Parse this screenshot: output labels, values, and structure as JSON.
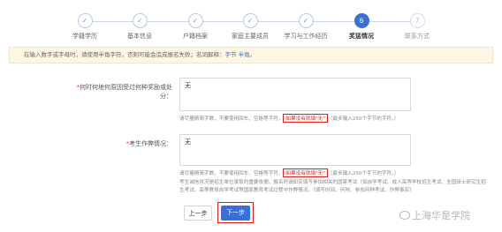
{
  "stepper": {
    "steps": [
      {
        "label": "学籍学历",
        "mark": "✓",
        "state": "done"
      },
      {
        "label": "基本信息",
        "mark": "✓",
        "state": "done"
      },
      {
        "label": "户籍档案",
        "mark": "✓",
        "state": "done"
      },
      {
        "label": "家庭主要成员",
        "mark": "✓",
        "state": "done"
      },
      {
        "label": "学习与工作经历",
        "mark": "✓",
        "state": "done"
      },
      {
        "label": "奖惩情况",
        "mark": "6",
        "state": "active"
      },
      {
        "label": "联系方式",
        "mark": "7",
        "state": "pending"
      }
    ]
  },
  "notice": {
    "text": "在输入数字或字母时，请使用半角字符，否则可能会造成报名失败；名词解释：",
    "link": "字节  半角。"
  },
  "form": {
    "punishment": {
      "label": "何时何地何原因受过何种奖励或处分：",
      "value": "无",
      "hint_prefix": "请尽量精简字数，不要使用回车、空格等字符，",
      "hint_highlight": "如果没有就填\"无\"",
      "hint_suffix": "（最多输入250个字节的字符。）"
    },
    "cheating": {
      "label": "考生作弊情况：",
      "value": "无",
      "hint_prefix": "请尽量精简字数，不要使用回车、空格等字符，",
      "hint_highlight": "如果没有就填\"无\"",
      "hint_suffix": "（最多输入250个字节的字符。）",
      "note_line1": "考生诚信状况是招生单位录取的重要依据。报名时请如实填写参加相关的国家考试（如自学考试、成人高等学校招生考试、全国硕士研究生招",
      "note_line2": "生考试、高等教育自学考试等国家教育考试过程中作弊情况。（填写时间、何地、参加何种考试、作弊事实）"
    }
  },
  "buttons": {
    "prev_label": "上一步",
    "next_label": "下一步"
  },
  "watermark": {
    "text": "上海华是学院"
  }
}
